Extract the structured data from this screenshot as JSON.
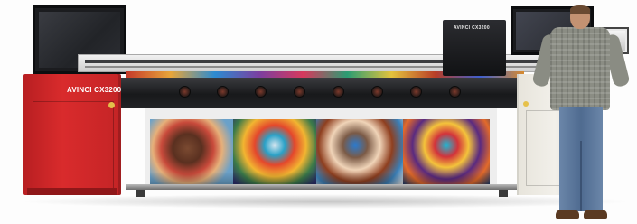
{
  "printer": {
    "left_logo": "AVINCI CX3200",
    "carriage_logo": "AVINCI CX3200",
    "colors": {
      "left_body": "#d92b2c",
      "right_body": "#f2f0ea",
      "beam": "#1c1d20"
    },
    "lamp_count": 8
  },
  "scene": {
    "person_present": true,
    "prints": [
      "face-art-1",
      "face-art-2",
      "face-art-3",
      "face-art-4"
    ]
  }
}
